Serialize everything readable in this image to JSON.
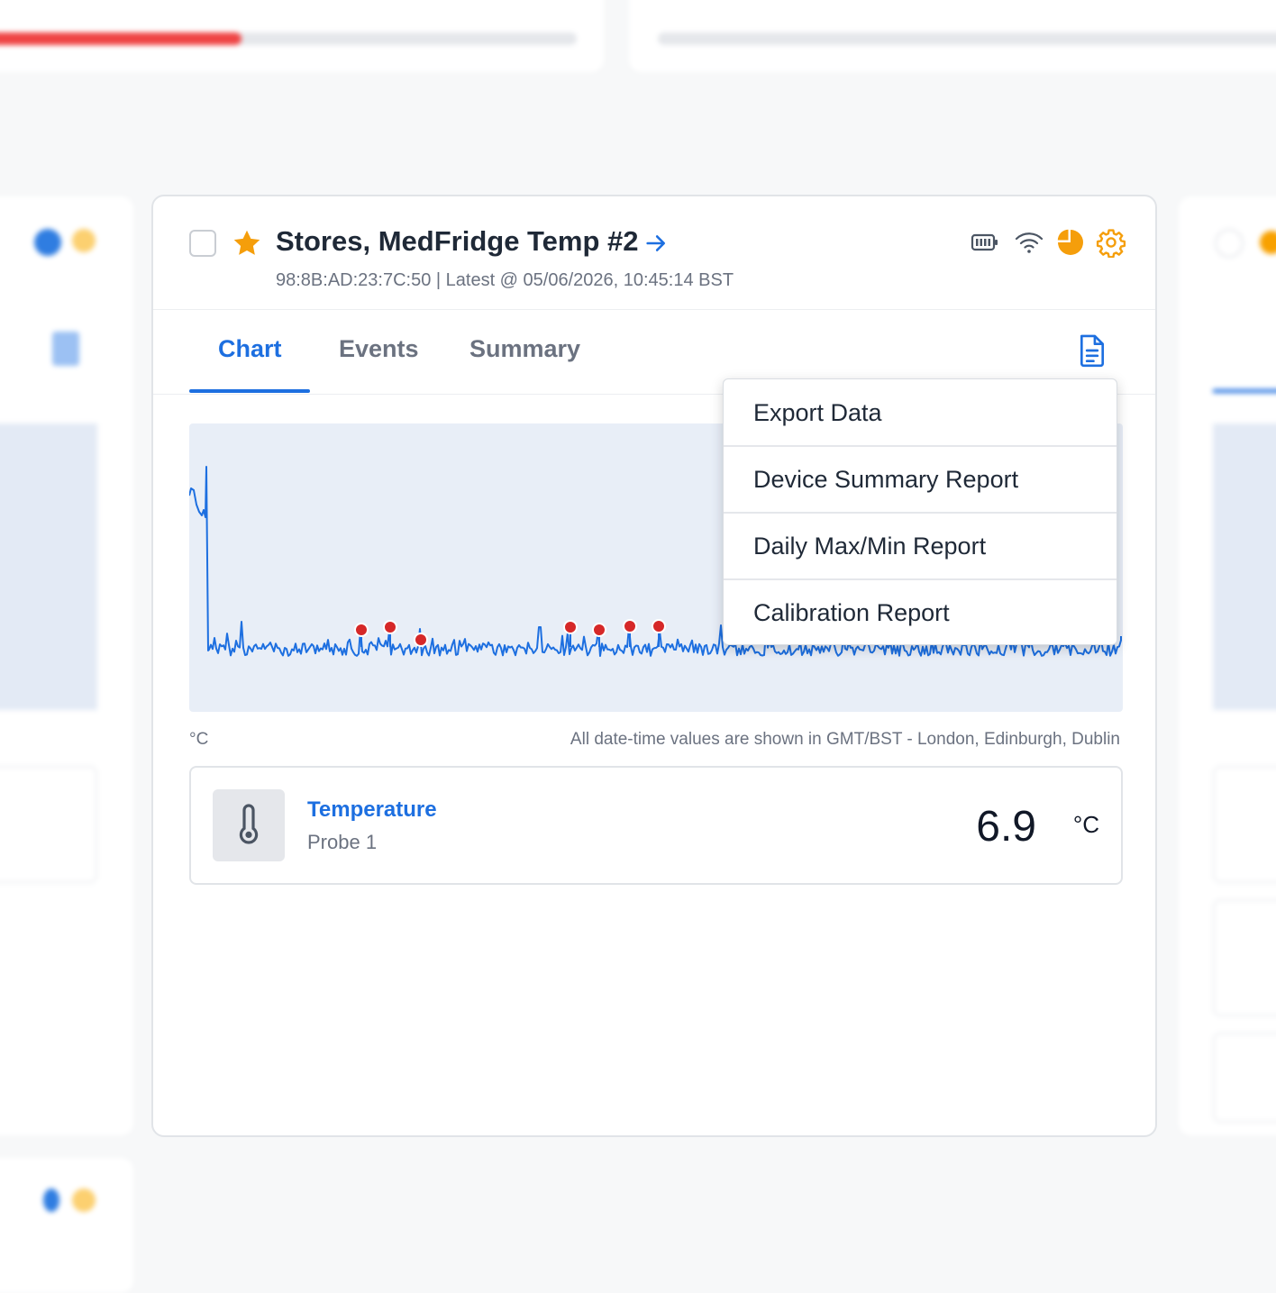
{
  "device": {
    "title": "Stores, MedFridge Temp #2",
    "subtitle": "98:8B:AD:23:7C:50 | Latest @ 05/06/2026, 10:45:14 BST"
  },
  "tabs": [
    {
      "label": "Chart",
      "active": true
    },
    {
      "label": "Events",
      "active": false
    },
    {
      "label": "Summary",
      "active": false
    }
  ],
  "report_menu": {
    "items": [
      "Export Data",
      "Device Summary Report",
      "Daily Max/Min Report",
      "Calibration Report"
    ]
  },
  "chart": {
    "unit_label": "°C",
    "timezone_note": "All date-time values are shown in GMT/BST - London, Edinburgh, Dublin",
    "series_color": "#1d6fe0",
    "event_marker_color": "#d62828"
  },
  "sensor": {
    "name": "Temperature",
    "probe": "Probe 1",
    "value": "6.9",
    "unit": "°C"
  },
  "colors": {
    "accent": "#1d6fe0",
    "star": "#f59e0b",
    "gear": "#f59e0b",
    "pie": "#f59e0b"
  },
  "icons": {
    "star": "star-icon",
    "arrow": "arrow-right-icon",
    "battery": "battery-icon",
    "wifi": "wifi-icon",
    "pie": "pie-icon",
    "gear": "gear-icon",
    "report": "report-icon",
    "thermometer": "thermometer-icon"
  }
}
